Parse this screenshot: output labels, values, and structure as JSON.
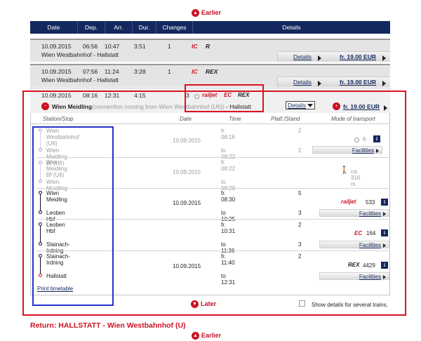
{
  "nav": {
    "earlier": "Earlier",
    "later": "Later"
  },
  "header": {
    "date": "Date",
    "dep": "Dep.",
    "arr": "Arr.",
    "dur": "Dur.",
    "changes": "Changes",
    "details": "Details"
  },
  "connections": [
    {
      "date": "10.09.2015",
      "dep": "06:56",
      "arr": "10:47",
      "dur": "3:51",
      "changes": "1",
      "products": [
        "IC",
        "R"
      ],
      "route": "Wien Westbahnhof - Hallstatt",
      "details": "Details",
      "price": "fr. 19.00 EUR"
    },
    {
      "date": "10.09.2015",
      "dep": "07:56",
      "arr": "11:24",
      "dur": "3:28",
      "changes": "1",
      "products": [
        "IC",
        "REX"
      ],
      "route": "Wien Westbahnhof - Hallstatt",
      "details": "Details",
      "price": "fr. 19.00 EUR"
    },
    {
      "date": "10.09.2015",
      "dep": "08:16",
      "arr": "12:31",
      "dur": "4:15",
      "changes": "3",
      "products": [
        "railjet",
        "EC",
        "REX"
      ],
      "route_from": "Wien Meidling",
      "route_note": "(connection coming from Wien Westbahnhof (U6))",
      "route_to": "- Hallstatt",
      "details": "Details",
      "price": "fr. 19.00 EUR"
    }
  ],
  "columns": {
    "station": "Station/Stop",
    "date": "Date",
    "time": "Time",
    "platform": "Platf./Stand",
    "mode": "Mode of transport"
  },
  "sections": [
    {
      "from": "Wien Westbahnhof (U6)",
      "to": "Wien Meidling Bf (U6)",
      "date": "10.09.2015",
      "dep": "fr. 08:16",
      "arr": "to 08:22",
      "plat_dep": "2",
      "plat_arr": "2",
      "train_num": "6",
      "facilities": "Facilities"
    },
    {
      "from": "Wien Meidling Bf (U6)",
      "to": "Wien Meidling",
      "date": "10.09.2015",
      "dep": "fr. 08:22",
      "arr": "to 08:28",
      "walk": "ca. 316 m"
    },
    {
      "from": "Wien Meidling",
      "to": "Leoben Hbf",
      "date": "10.09.2015",
      "dep": "fr. 08:30",
      "arr": "to 10:25",
      "plat_dep": "5",
      "plat_arr": "3",
      "product": "railjet",
      "train_num": "533",
      "facilities": "Facilities"
    },
    {
      "from": "Leoben Hbf",
      "to": "Stainach-Irdning",
      "date": "10.09.2015",
      "dep": "fr. 10:31",
      "arr": "to 11:36",
      "plat_dep": "2",
      "plat_arr": "3",
      "product": "EC",
      "train_num": "164",
      "facilities": "Facilities"
    },
    {
      "from": "Stainach-Irdning",
      "to": "Hallstatt",
      "date": "10.09.2015",
      "dep": "fr. 11:40",
      "arr": "to 12:31",
      "plat_dep": "2",
      "product": "REX",
      "train_num": "4429",
      "facilities": "Facilities"
    }
  ],
  "print": "Print timetable",
  "show_details": "Show details for several trains.",
  "return_title": "Return: HALLSTATT - Wien Westbahnhof (U)",
  "colors": {
    "navy": "#14285e",
    "red": "#cc1122",
    "highlight_red": "#dd1122",
    "highlight_blue": "#2233cc"
  }
}
